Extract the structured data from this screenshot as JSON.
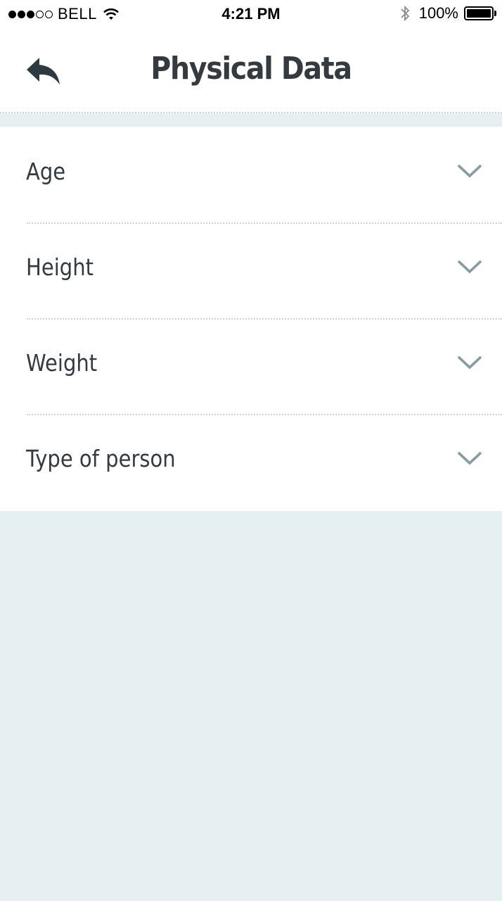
{
  "status_bar": {
    "carrier": "BELL",
    "time": "4:21 PM",
    "battery_percent": "100%",
    "signal_bars_filled": 3,
    "signal_bars_total": 5,
    "icons": [
      "wifi-icon",
      "bluetooth-icon",
      "battery-icon"
    ]
  },
  "header": {
    "title": "Physical Data",
    "back_icon": "reply-arrow-icon"
  },
  "list": {
    "items": [
      {
        "label": "Age",
        "icon": "chevron-down-icon"
      },
      {
        "label": "Height",
        "icon": "chevron-down-icon"
      },
      {
        "label": "Weight",
        "icon": "chevron-down-icon"
      },
      {
        "label": "Type of person",
        "icon": "chevron-down-icon"
      }
    ]
  },
  "colors": {
    "background": "#e6eff2",
    "surface": "#ffffff",
    "text": "#343a3f",
    "chevron": "#8a9ba1",
    "divider": "#c9d6da"
  }
}
